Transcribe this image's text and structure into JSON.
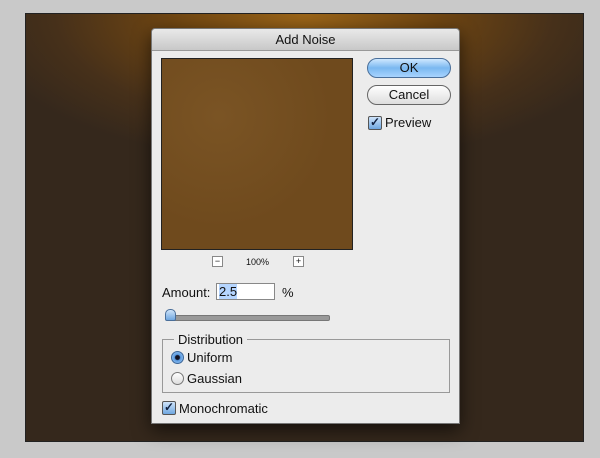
{
  "dialog": {
    "title": "Add Noise",
    "ok": "OK",
    "cancel": "Cancel",
    "preview": "Preview",
    "zoom": "100%",
    "zoom_out": "−",
    "zoom_in": "+",
    "amount_label": "Amount:",
    "amount_value": "2.5",
    "amount_unit": "%",
    "distribution": "Distribution",
    "uniform": "Uniform",
    "gaussian": "Gaussian",
    "monochromatic": "Monochromatic",
    "check": "✓"
  }
}
